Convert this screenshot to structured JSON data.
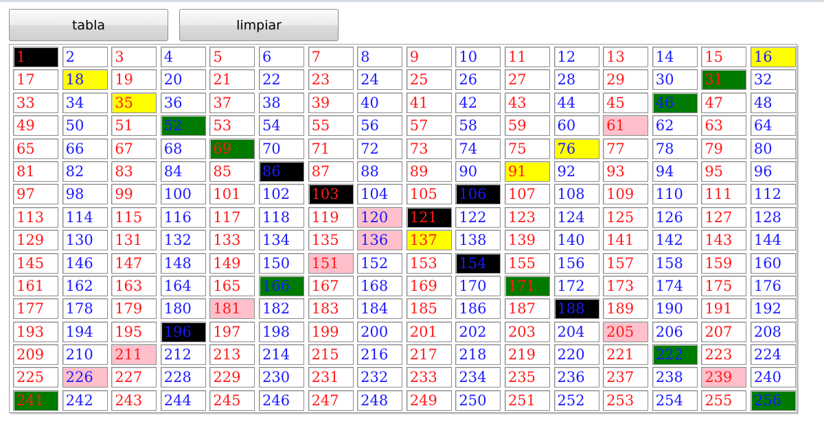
{
  "toolbar": {
    "tabla_label": "tabla",
    "limpiar_label": "limpiar"
  },
  "grid": {
    "count": 256,
    "columns": 16,
    "colors": {
      "odd_text": "#ff1a1a",
      "even_text": "#1a1aff",
      "black": "#000000",
      "yellow": "#ffff00",
      "green": "#007a00",
      "pink": "#ffc0cb"
    },
    "highlights": {
      "black": [
        1,
        86,
        103,
        106,
        121,
        154,
        188,
        196
      ],
      "yellow": [
        16,
        18,
        35,
        76,
        91,
        137
      ],
      "green": [
        31,
        46,
        52,
        69,
        166,
        171,
        222,
        241,
        256
      ],
      "pink": [
        61,
        120,
        136,
        151,
        181,
        205,
        211,
        226,
        239
      ]
    }
  }
}
